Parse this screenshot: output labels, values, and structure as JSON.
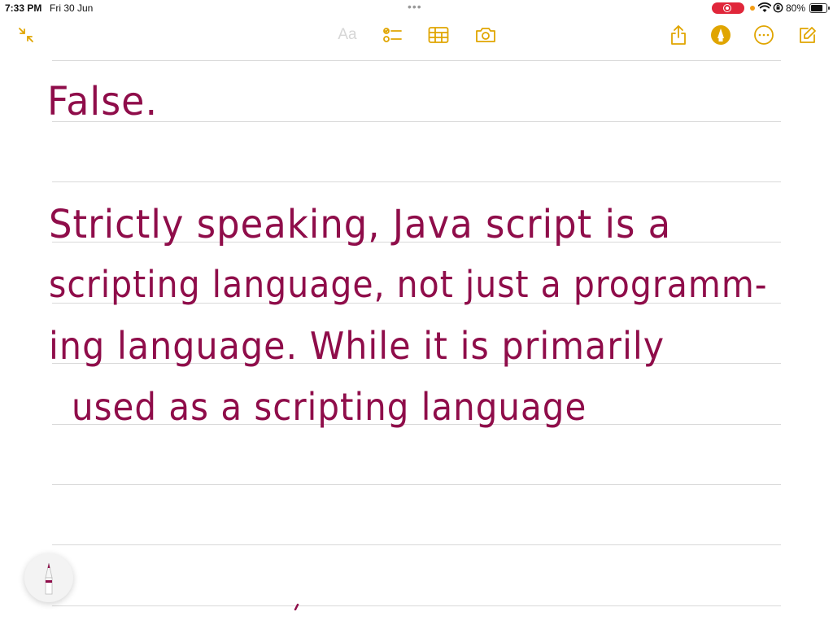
{
  "status_bar": {
    "time": "7:33 PM",
    "date": "Fri 30 Jun",
    "battery_percent": "80%",
    "recording_color": "#e0263a",
    "battery_level": 0.8
  },
  "toolbar": {
    "format_label": "Aa",
    "accent_color": "#e0a500",
    "icons": [
      "collapse-icon",
      "checklist-icon",
      "table-icon",
      "camera-icon",
      "share-icon",
      "markup-icon",
      "more-icon",
      "compose-icon"
    ]
  },
  "note": {
    "ink_color": "#8f0d4a",
    "lines": [
      "False.",
      "Strictly speaking, Java script is a",
      "scripting language, not just a programm-",
      "ing language. While it is primarily",
      "used as a scripting language"
    ]
  }
}
